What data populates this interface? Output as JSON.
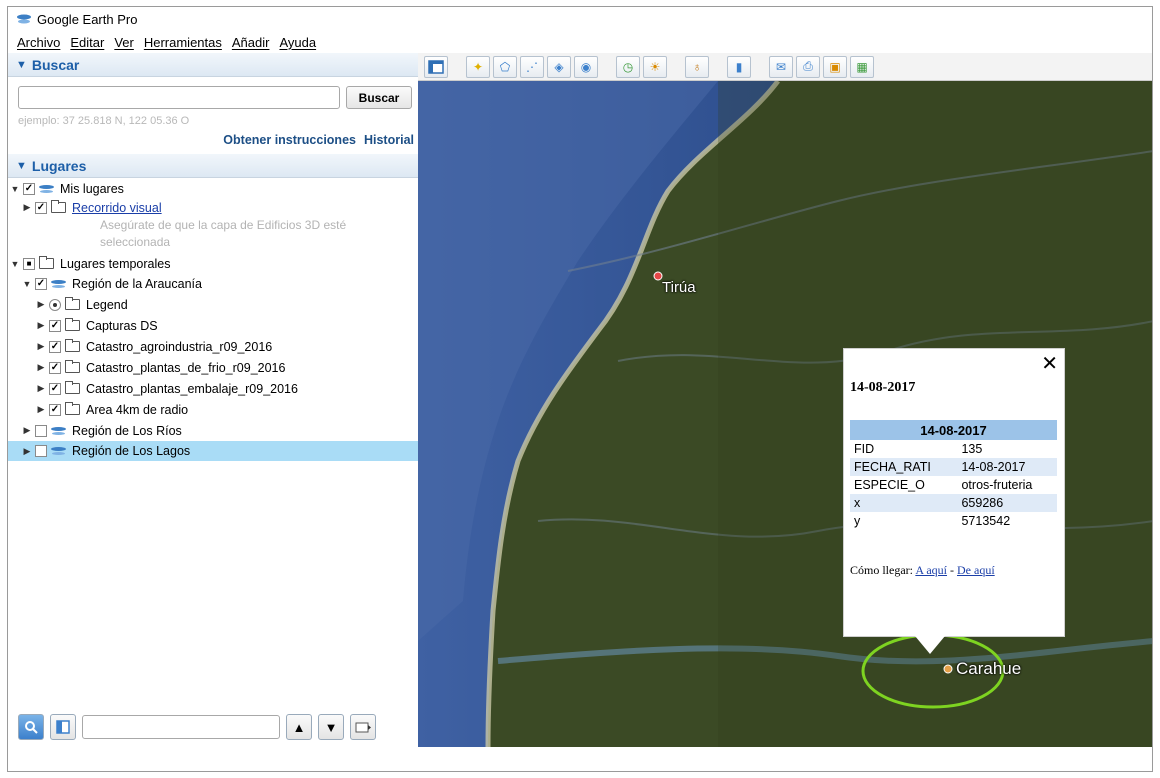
{
  "window": {
    "title": "Google Earth Pro"
  },
  "menu": [
    "Archivo",
    "Editar",
    "Ver",
    "Herramientas",
    "Añadir",
    "Ayuda"
  ],
  "search": {
    "header": "Buscar",
    "button": "Buscar",
    "example": "ejemplo: 37 25.818 N, 122 05.36 O",
    "directions_link": "Obtener instrucciones",
    "history_link": "Historial"
  },
  "places": {
    "header": "Lugares",
    "items": [
      {
        "label": "Mis lugares"
      },
      {
        "label": "Recorrido visual"
      },
      {
        "label": "Asegúrate de que la capa de Edificios 3D esté seleccionada"
      },
      {
        "label": "Lugares temporales"
      },
      {
        "label": "Región de la Araucanía"
      },
      {
        "label": "Legend"
      },
      {
        "label": "Capturas DS"
      },
      {
        "label": "Catastro_agroindustria_r09_2016"
      },
      {
        "label": "Catastro_plantas_de_frio_r09_2016"
      },
      {
        "label": "Catastro_plantas_embalaje_r09_2016"
      },
      {
        "label": "Area 4km de radio"
      },
      {
        "label": "Región de Los Ríos"
      },
      {
        "label": "Región de Los Lagos"
      }
    ]
  },
  "map": {
    "labels": {
      "tirua": "Tirúa",
      "carahue": "Carahue"
    }
  },
  "popup": {
    "title": "14-08-2017",
    "table_header": "14-08-2017",
    "rows": [
      {
        "key": "FID",
        "value": "135"
      },
      {
        "key": "FECHA_RATI",
        "value": "14-08-2017"
      },
      {
        "key": "ESPECIE_O",
        "value": "otros-fruteria"
      },
      {
        "key": "x",
        "value": "659286"
      },
      {
        "key": "y",
        "value": "5713542"
      }
    ],
    "directions_label": "Cómo llegar:",
    "to_here": "A aquí",
    "separator": "-",
    "from_here": "De aquí"
  },
  "colors": {
    "accent": "#1d5fa8",
    "selection": "#a9dcf6",
    "popup_header": "#9cc3e8"
  }
}
